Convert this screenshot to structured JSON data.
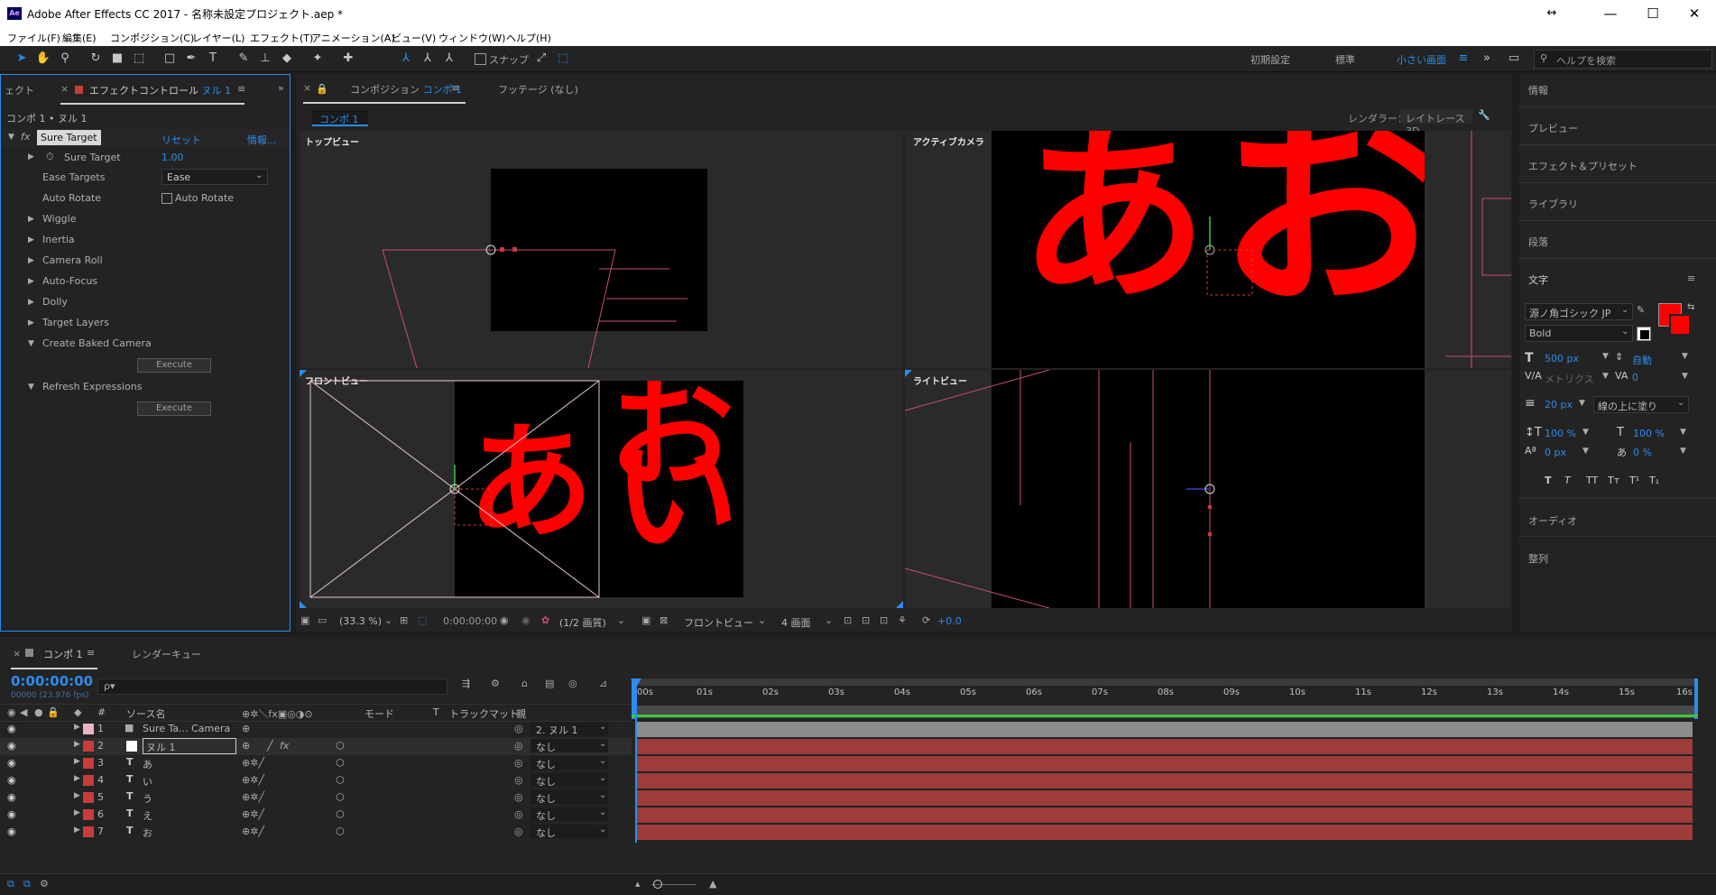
{
  "app": {
    "icon_text": "Ae",
    "title": "Adobe After Effects CC 2017 - 名称未設定プロジェクト.aep *"
  },
  "window_controls": {
    "resize": "↔",
    "minimize": "—",
    "maximize": "☐",
    "close": "✕"
  },
  "menu": [
    "ファイル(F)",
    "編集(E)",
    "コンポジション(C)",
    "レイヤー(L)",
    "エフェクト(T)",
    "アニメーション(A)",
    "ビュー(V)",
    "ウィンドウ(W)",
    "ヘルプ(H)"
  ],
  "toolbar": {
    "snap_label": "スナップ",
    "workspaces": [
      "初期設定",
      "標準",
      "小さい画面"
    ],
    "active_workspace": "小さい画面",
    "search_placeholder": "ヘルプを検索"
  },
  "effect_panel": {
    "tab_partial": "ェクト",
    "tab_label": "エフェクトコントロール ヌル 1",
    "tab_prefix": "エフェクトコントロール",
    "tab_layer": "ヌル 1",
    "breadcrumb": "コンポ 1 • ヌル 1",
    "fx_label": "fx",
    "effect_name": "Sure Target",
    "reset": "リセット",
    "info": "情報...",
    "properties": [
      {
        "label": "Sure Target",
        "value": "1.00"
      },
      {
        "label": "Ease Targets",
        "value": "Ease"
      },
      {
        "label": "Auto Rotate",
        "value": "Auto Rotate"
      },
      {
        "label": "Wiggle"
      },
      {
        "label": "Inertia"
      },
      {
        "label": "Camera Roll"
      },
      {
        "label": "Auto-Focus"
      },
      {
        "label": "Dolly"
      },
      {
        "label": "Target Layers"
      },
      {
        "label": "Create Baked Camera"
      },
      {
        "label": "Refresh Expressions"
      }
    ],
    "execute_label": "Execute"
  },
  "comp_panel": {
    "tab_prefix": "コンポジション",
    "tab_comp": "コンポ 1",
    "footage_tab": "フッテージ (なし)",
    "comp_chip": "コンポ 1",
    "renderer_label": "レンダラー：",
    "renderer_value": "レイトレース 3D",
    "views": [
      "トップビュー",
      "アクティブカメラ",
      "フロントビュー",
      "ライトビュー"
    ],
    "glyphs": [
      "あ",
      "い",
      "お"
    ],
    "footer": {
      "zoom": "(33.3 %)",
      "timecode": "0:00:00:00",
      "resolution": "(1/2 画質)",
      "view": "フロントビュー",
      "layout": "4 画面",
      "exposure": "+0.0"
    }
  },
  "right_panel": {
    "items_top": [
      "情報",
      "プレビュー",
      "エフェクト＆プリセット",
      "ライブラリ",
      "段落",
      "文字"
    ],
    "font_family": "源ノ角ゴシック JP",
    "font_style": "Bold",
    "font_size": "500 px",
    "leading": "自動",
    "kerning": "メトリクス",
    "tracking": "0",
    "stroke_width": "20 px",
    "stroke_mode": "線の上に塗り",
    "vert_scale": "100 %",
    "horiz_scale": "100 %",
    "baseline": "0 px",
    "tsume": "0 %",
    "style_buttons": [
      "T",
      "T",
      "TT",
      "Tт",
      "T¹",
      "T₁"
    ],
    "fill_color": "#ff0000",
    "items_bottom": [
      "オーディオ",
      "整列"
    ]
  },
  "timeline": {
    "tab_comp": "コンポ 1",
    "tab_render": "レンダーキュー",
    "timecode": "0:00:00:00",
    "fps_sub": "00000 (23.976 fps)",
    "search_placeholder": "ρ▾",
    "columns": {
      "num": "#",
      "source": "ソース名",
      "mode": "モード",
      "t": "T",
      "trackmat": "トラックマット",
      "parent": "親"
    },
    "layers": [
      {
        "num": "1",
        "type": "camera",
        "name": "Sure Ta... Camera",
        "parent": "2. ヌル 1",
        "label_color": "#e8b4c8"
      },
      {
        "num": "2",
        "type": "null",
        "name": "ヌル 1",
        "parent": "なし",
        "label_color": "#c83c3c"
      },
      {
        "num": "3",
        "type": "text",
        "name": "あ",
        "parent": "なし",
        "label_color": "#c83c3c"
      },
      {
        "num": "4",
        "type": "text",
        "name": "い",
        "parent": "なし",
        "label_color": "#c83c3c"
      },
      {
        "num": "5",
        "type": "text",
        "name": "う",
        "parent": "なし",
        "label_color": "#c83c3c"
      },
      {
        "num": "6",
        "type": "text",
        "name": "え",
        "parent": "なし",
        "label_color": "#c83c3c"
      },
      {
        "num": "7",
        "type": "text",
        "name": "お",
        "parent": "なし",
        "label_color": "#c83c3c"
      }
    ],
    "ruler": [
      "00s",
      "01s",
      "02s",
      "03s",
      "04s",
      "05s",
      "06s",
      "07s",
      "08s",
      "09s",
      "10s",
      "11s",
      "12s",
      "13s",
      "14s",
      "15s",
      "16s"
    ],
    "colors": {
      "camera_bar": "#8c8c8c",
      "layer_bar": "#9e3b3b",
      "accent": "#2d8ceb"
    }
  }
}
